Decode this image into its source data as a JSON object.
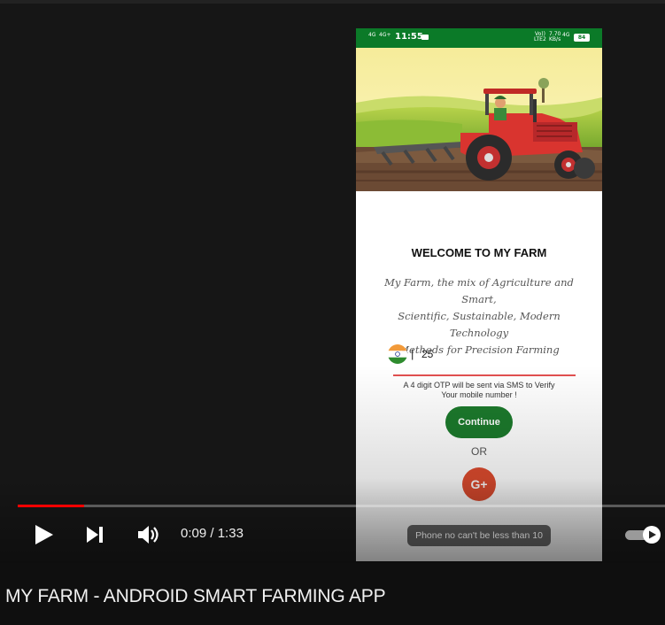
{
  "phone": {
    "status_bar": {
      "time": "11:55",
      "net_left_1": "4G",
      "net_left_2": "4G+",
      "net_right_1": "Vo))",
      "net_right_2": "LTE2",
      "speed": "7.70",
      "speed_unit": "KB/s",
      "network_type": "4G",
      "battery": "84"
    },
    "welcome_title": "WELCOME TO MY FARM",
    "tagline_lines": [
      "My Farm, the mix of Agriculture and Smart,",
      "Scientific, Sustainable, Modern Technology",
      "Methods for Precision Farming"
    ],
    "phone_input_value": "25",
    "otp_note_lines": [
      "A 4 digit OTP will be sent via SMS to Verify",
      "Your mobile number !"
    ],
    "continue_label": "Continue",
    "or_label": "OR",
    "google_label": "G+",
    "toast": "Phone no can't be less than 10"
  },
  "player": {
    "progress": 0.102,
    "time_current": "0:09",
    "time_separator": " / ",
    "time_total": "1:33",
    "progress_color": "#ff0000"
  },
  "video_title": "MY FARM - ANDROID SMART FARMING APP",
  "icons": [
    "play-icon",
    "next-icon",
    "volume-icon",
    "autoplay-toggle-icon",
    "india-flag-icon",
    "google-plus-icon",
    "tractor-illustration"
  ]
}
